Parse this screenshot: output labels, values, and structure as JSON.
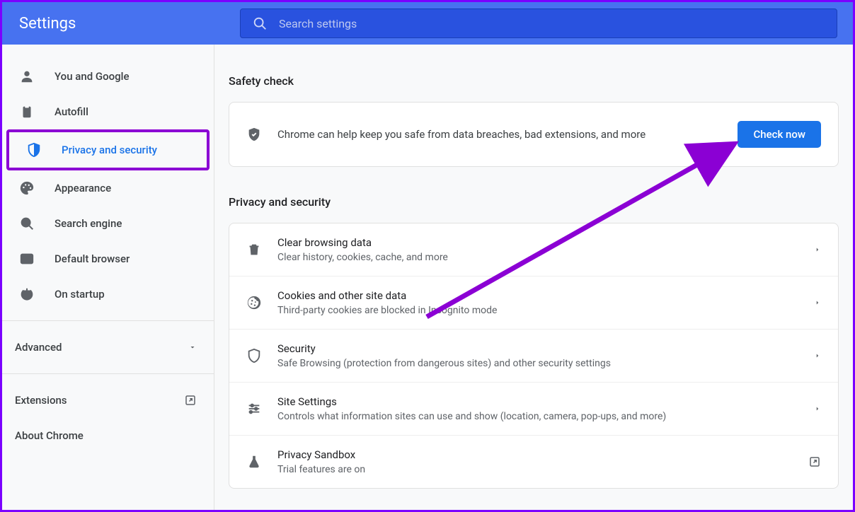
{
  "header": {
    "title": "Settings",
    "search_placeholder": "Search settings"
  },
  "sidebar": {
    "items": [
      {
        "label": "You and Google"
      },
      {
        "label": "Autofill"
      },
      {
        "label": "Privacy and security"
      },
      {
        "label": "Appearance"
      },
      {
        "label": "Search engine"
      },
      {
        "label": "Default browser"
      },
      {
        "label": "On startup"
      }
    ],
    "advanced": "Advanced",
    "extensions": "Extensions",
    "about": "About Chrome"
  },
  "main": {
    "safety_title": "Safety check",
    "safety_text": "Chrome can help keep you safe from data breaches, bad extensions, and more",
    "check_btn": "Check now",
    "privacy_title": "Privacy and security",
    "rows": [
      {
        "title": "Clear browsing data",
        "sub": "Clear history, cookies, cache, and more"
      },
      {
        "title": "Cookies and other site data",
        "sub": "Third-party cookies are blocked in Incognito mode"
      },
      {
        "title": "Security",
        "sub": "Safe Browsing (protection from dangerous sites) and other security settings"
      },
      {
        "title": "Site Settings",
        "sub": "Controls what information sites can use and show (location, camera, pop-ups, and more)"
      },
      {
        "title": "Privacy Sandbox",
        "sub": "Trial features are on"
      }
    ]
  }
}
